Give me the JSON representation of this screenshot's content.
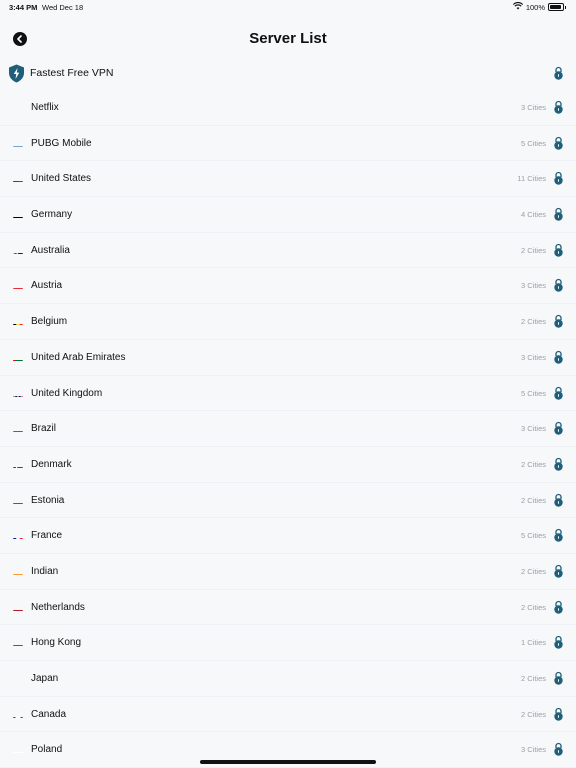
{
  "status": {
    "time": "3:44 PM",
    "date": "Wed Dec 18",
    "battery": "100%"
  },
  "nav": {
    "title": "Server List"
  },
  "fastest": {
    "label": "Fastest Free VPN"
  },
  "colors": {
    "accent": "#1f5f7a",
    "lock": "#1f5f7a"
  },
  "servers": [
    {
      "name": "Netflix",
      "cities": "3 Cities",
      "flag": "netflix"
    },
    {
      "name": "PUBG Mobile",
      "cities": "5 Cities",
      "flag": "pubg"
    },
    {
      "name": "United States",
      "cities": "11 Cities",
      "flag": "us"
    },
    {
      "name": "Germany",
      "cities": "4 Cities",
      "flag": "de"
    },
    {
      "name": "Australia",
      "cities": "2 Cities",
      "flag": "au"
    },
    {
      "name": "Austria",
      "cities": "3 Cities",
      "flag": "at"
    },
    {
      "name": "Belgium",
      "cities": "2 Cities",
      "flag": "be"
    },
    {
      "name": "United Arab Emirates",
      "cities": "3 Cities",
      "flag": "ae"
    },
    {
      "name": "United Kingdom",
      "cities": "5 Cities",
      "flag": "gb"
    },
    {
      "name": "Brazil",
      "cities": "3 Cities",
      "flag": "br"
    },
    {
      "name": "Denmark",
      "cities": "2 Cities",
      "flag": "dk"
    },
    {
      "name": "Estonia",
      "cities": "2 Cities",
      "flag": "ee"
    },
    {
      "name": "France",
      "cities": "5 Cities",
      "flag": "fr"
    },
    {
      "name": "Indian",
      "cities": "2 Cities",
      "flag": "in"
    },
    {
      "name": "Netherlands",
      "cities": "2 Cities",
      "flag": "nl"
    },
    {
      "name": "Hong Kong",
      "cities": "1 Cities",
      "flag": "hk"
    },
    {
      "name": "Japan",
      "cities": "2 Cities",
      "flag": "jp"
    },
    {
      "name": "Canada",
      "cities": "2 Cities",
      "flag": "ca"
    },
    {
      "name": "Poland",
      "cities": "3 Cities",
      "flag": "pl"
    }
  ]
}
